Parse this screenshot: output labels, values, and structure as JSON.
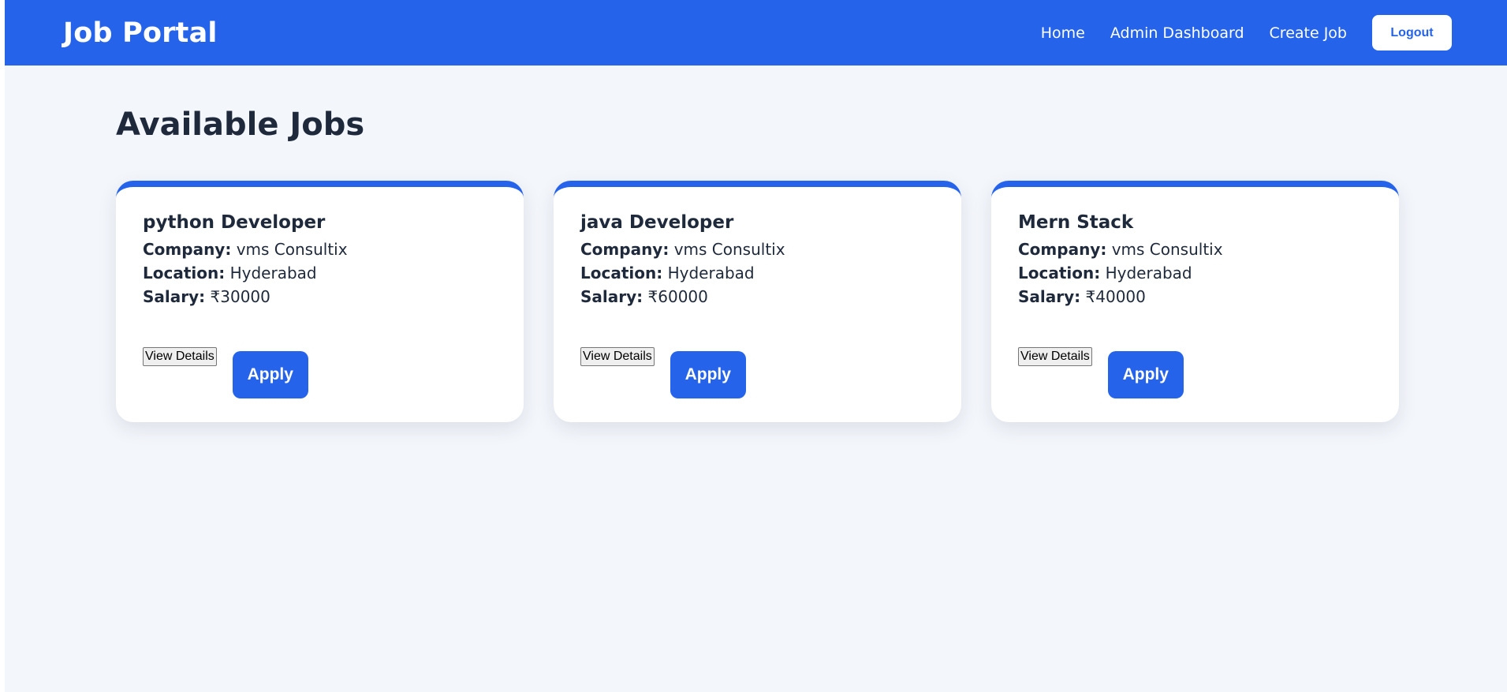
{
  "header": {
    "brand": "Job Portal",
    "nav": {
      "home": "Home",
      "admin_dashboard": "Admin Dashboard",
      "create_job": "Create Job",
      "logout": "Logout"
    }
  },
  "main": {
    "title": "Available Jobs",
    "field_labels": {
      "company": "Company:",
      "location": "Location:",
      "salary": "Salary:"
    },
    "buttons": {
      "view_details": "View Details",
      "apply": "Apply"
    },
    "jobs": [
      {
        "title": "python Developer",
        "company": "vms Consultix",
        "location": "Hyderabad",
        "salary": "₹30000"
      },
      {
        "title": "java Developer",
        "company": "vms Consultix",
        "location": "Hyderabad",
        "salary": "₹60000"
      },
      {
        "title": "Mern Stack",
        "company": "vms Consultix",
        "location": "Hyderabad",
        "salary": "₹40000"
      }
    ]
  },
  "colors": {
    "primary": "#2563eb",
    "background": "#f3f6fb",
    "text": "#1e293b",
    "card": "#ffffff"
  }
}
